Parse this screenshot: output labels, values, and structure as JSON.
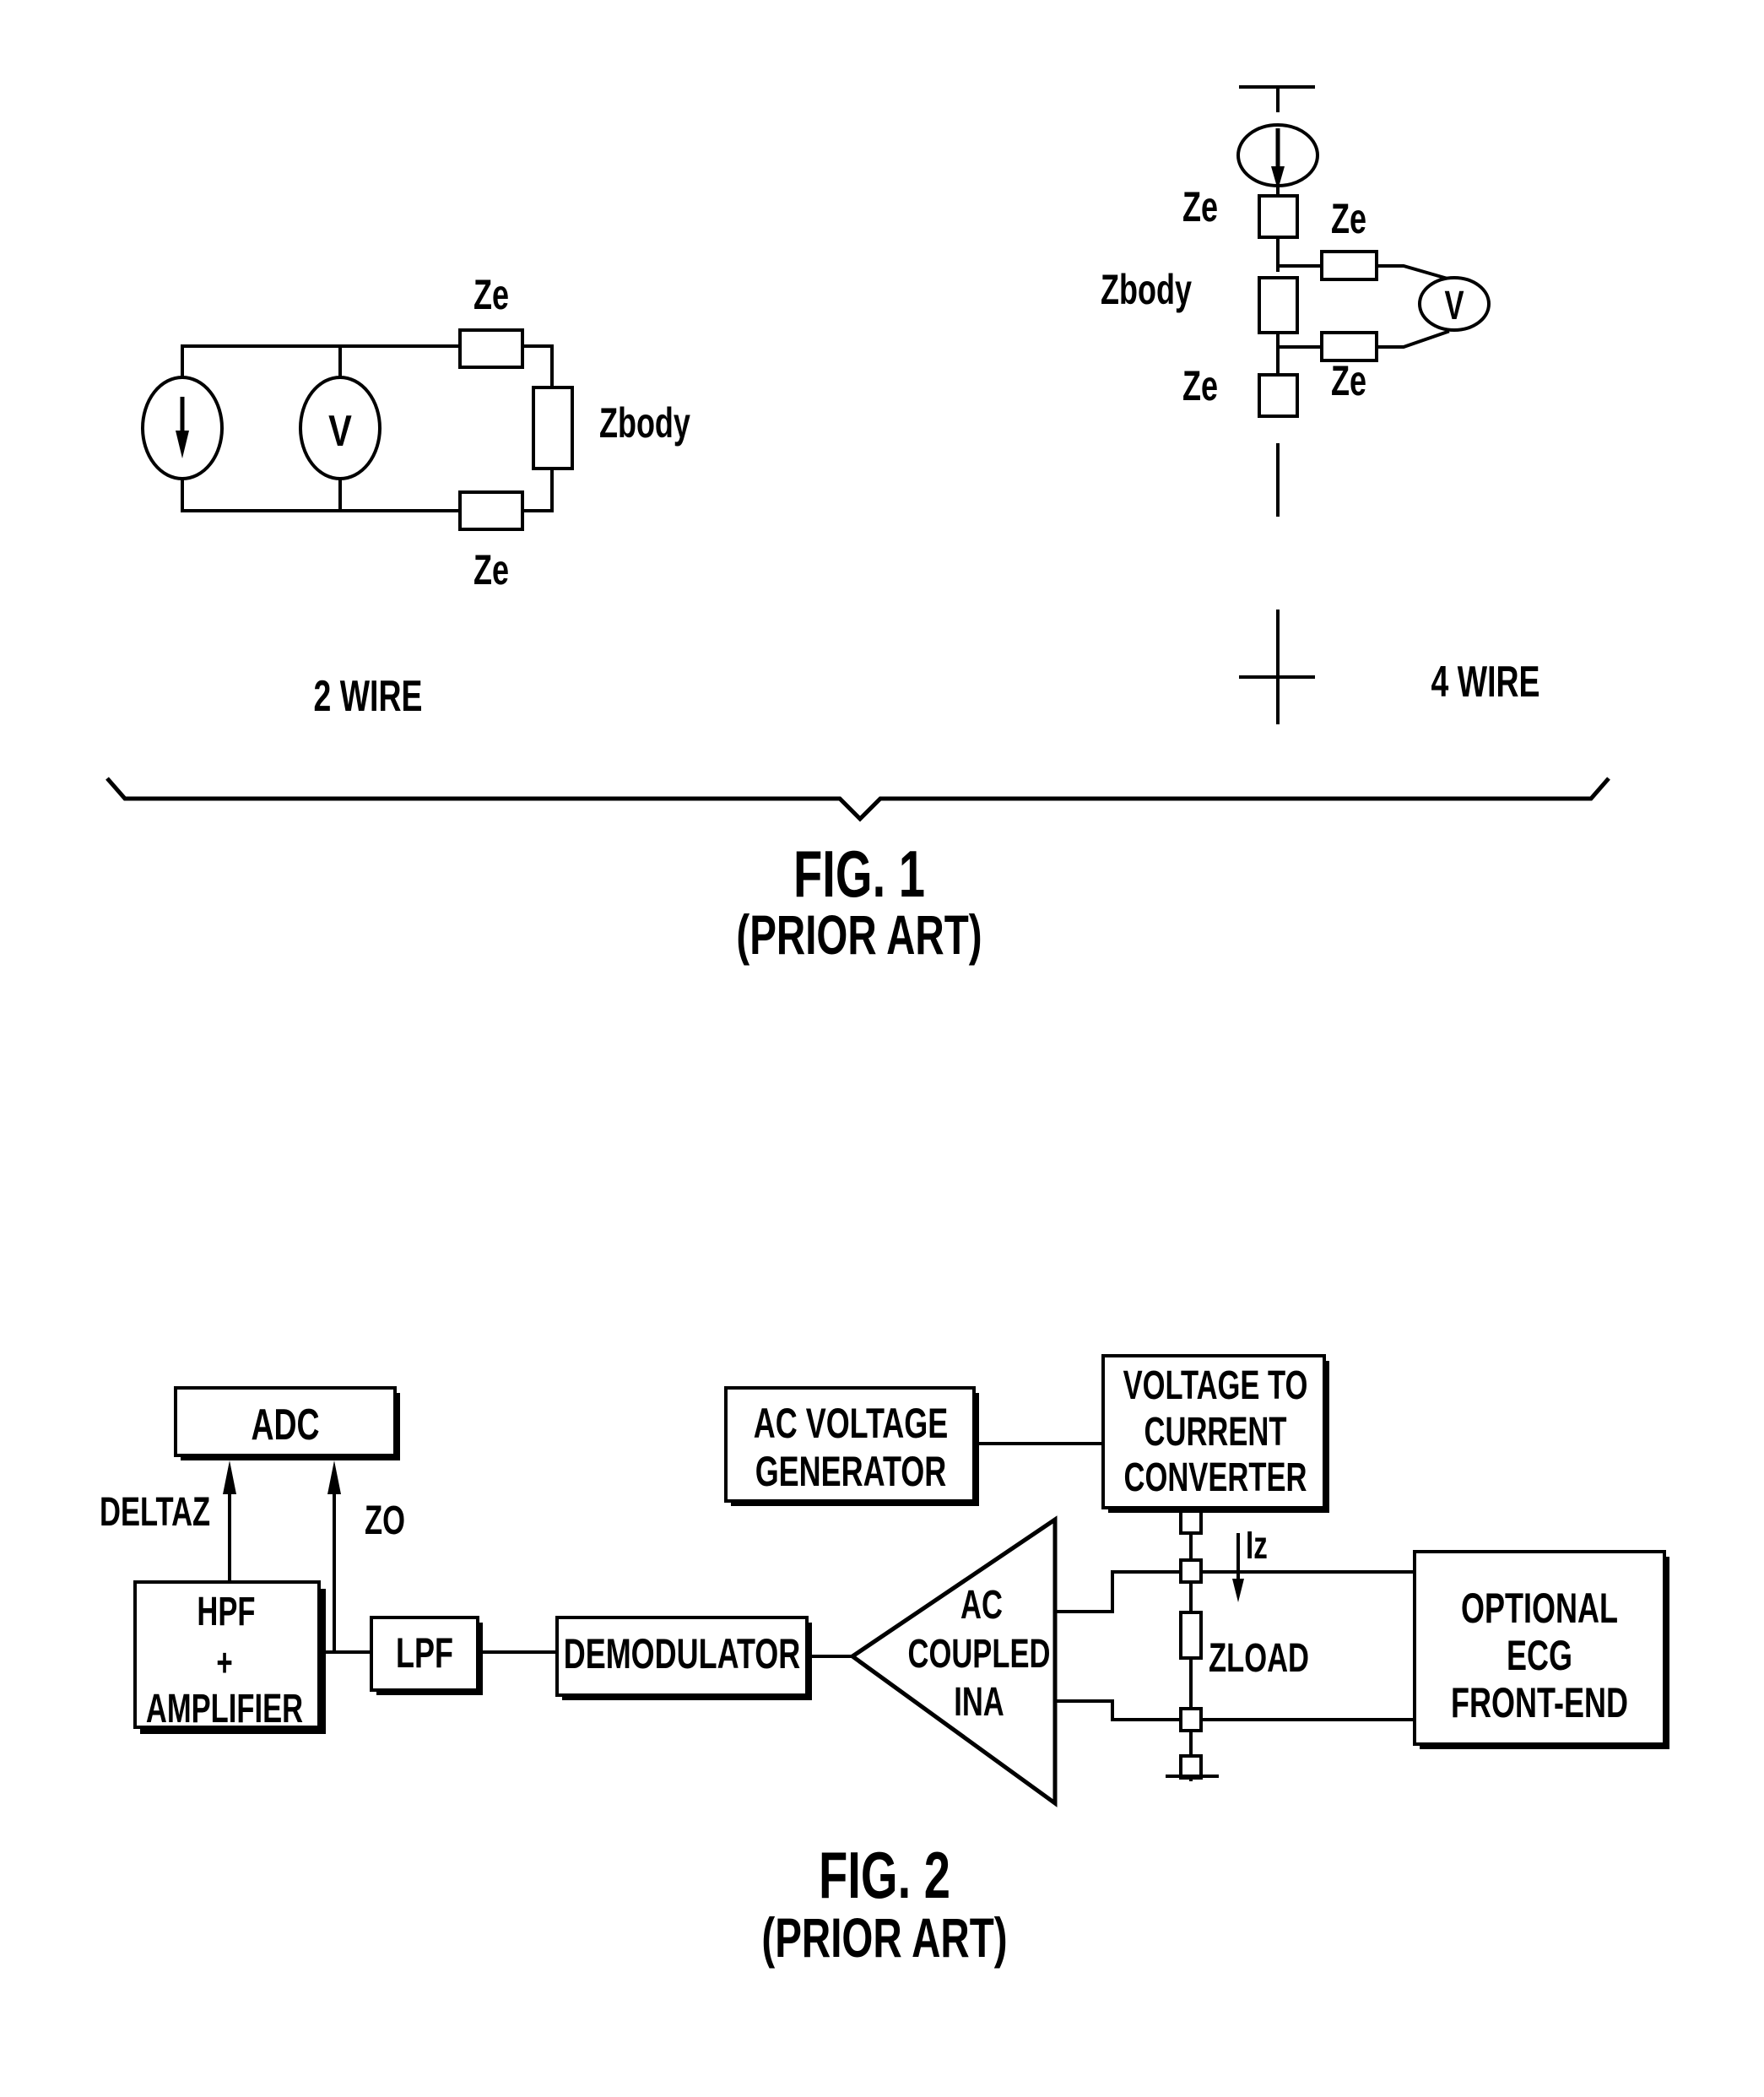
{
  "fig1": {
    "two_wire": {
      "caption": "2 WIRE",
      "labels": {
        "ze_top": "Ze",
        "ze_bottom": "Ze",
        "zbody": "Zbody",
        "voltmeter": "V"
      },
      "components": [
        "current-source",
        "voltmeter",
        "ze-top",
        "zbody",
        "ze-bottom"
      ]
    },
    "four_wire": {
      "caption": "4 WIRE",
      "labels": {
        "ze_upper": "Ze",
        "ze_lower": "Ze",
        "zbody": "Zbody",
        "ze_sense_top": "Ze",
        "ze_sense_bottom": "Ze",
        "voltmeter": "V"
      },
      "components": [
        "current-source",
        "ze-upper",
        "zbody",
        "ze-lower",
        "ze-sense-top",
        "ze-sense-bottom",
        "voltmeter"
      ]
    },
    "title": "FIG. 1",
    "subtitle": "(PRIOR ART)"
  },
  "fig2": {
    "blocks": {
      "adc": "ADC",
      "hpf": [
        "HPF",
        "+",
        "AMPLIFIER"
      ],
      "lpf": "LPF",
      "demodulator": "DEMODULATOR",
      "ac_generator": [
        "AC VOLTAGE",
        "GENERATOR"
      ],
      "v2i": [
        "VOLTAGE TO",
        "CURRENT",
        "CONVERTER"
      ],
      "ina": [
        "AC",
        "COUPLED",
        "INA"
      ],
      "ecg": [
        "OPTIONAL",
        "ECG",
        "FRONT-END"
      ]
    },
    "signals": {
      "deltaz": "DELTAZ",
      "zo": "ZO",
      "iz": "Iz",
      "zload": "ZLOAD"
    },
    "title": "FIG. 2",
    "subtitle": "(PRIOR ART)"
  }
}
